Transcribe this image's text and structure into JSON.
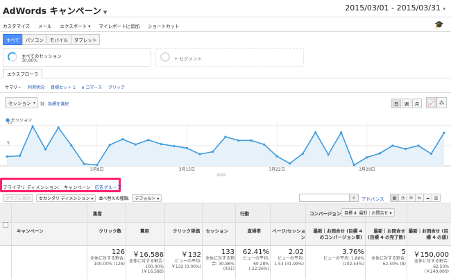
{
  "header": {
    "title": "AdWords キャンペーン",
    "date_range": "2015/03/01 - 2015/03/31"
  },
  "toolbar": {
    "items": [
      "カスタマイズ",
      "メール",
      "エクスポート ▾",
      "マイレポートに追加",
      "ショートカット"
    ]
  },
  "segment_buttons": [
    "すべて",
    "パソコン",
    "モバイル",
    "タブレット"
  ],
  "segments": {
    "primary_name": "すべてのセッション",
    "primary_value": "30.86%",
    "add_label": "+ セグメント"
  },
  "tab": "エクスプローラ",
  "subnav": [
    "サマリー",
    "利用状況",
    "目標セット 1",
    "e コマース",
    "クリック"
  ],
  "chart_controls": {
    "metric": "セッション",
    "vs": "対",
    "new_metric": "指標を選択",
    "periods": [
      "日",
      "週",
      "月"
    ]
  },
  "colors": {
    "accent": "#4d90fe",
    "line": "#3f9bdc",
    "highlight": "#ff1d6c",
    "link": "#1a55b5"
  },
  "chart_data": {
    "type": "area",
    "series": [
      {
        "name": "セッション",
        "values": [
          2.3,
          2.5,
          9.8,
          4.1,
          9.5,
          5.1,
          0.5,
          0.2,
          5.2,
          6.6,
          5.3,
          6.4,
          5.4,
          4.9,
          4.4,
          2.9,
          3.5,
          7.2,
          6.3,
          6.3,
          5.3,
          2.4,
          0.6,
          3.0,
          8.3,
          2.8,
          8.3,
          0.2,
          2.1,
          3.1,
          5.0,
          4.2,
          5.0,
          3.0,
          8.2
        ]
      }
    ],
    "x": [
      "2015-03-01",
      "2015-03-02",
      "2015-03-03",
      "2015-03-04",
      "2015-03-05",
      "2015-03-06",
      "2015-03-07",
      "2015-03-08",
      "2015-03-09",
      "2015-03-10",
      "2015-03-11",
      "2015-03-12",
      "2015-03-13",
      "2015-03-14",
      "2015-03-15",
      "2015-03-16",
      "2015-03-17",
      "2015-03-18",
      "2015-03-19",
      "2015-03-20",
      "2015-03-21",
      "2015-03-22",
      "2015-03-23",
      "2015-03-24",
      "2015-03-25",
      "2015-03-26",
      "2015-03-27",
      "2015-03-28",
      "2015-03-29",
      "2015-03-30",
      "2015-03-31",
      "2015-04-01",
      "2015-04-02",
      "2015-04-03",
      "2015-04-04"
    ],
    "x_tick_labels": [
      "3月8日",
      "3月15日",
      "3月22日",
      "3月29日"
    ],
    "y_tick_labels": [
      "10",
      "5"
    ],
    "ylim": [
      0,
      11
    ],
    "grid": true
  },
  "dimensions": {
    "label": "プライマリ ディメンション:",
    "active": "キャンペーン",
    "other": "広告グループ"
  },
  "table_controls": {
    "plot_rows": "グラフに表示",
    "secondary": "セカンダリ ディメンション ▾",
    "sort_label": "並べ替えの種類:",
    "sort_value": "デフォルト ▾",
    "advanced": "アドバンス"
  },
  "table": {
    "groups": [
      "集客",
      "行動",
      "コンバージョン"
    ],
    "conversion_select": "目標 4: 最新｜お問合せ ▾",
    "columns": [
      {
        "label": "キャンペーン"
      },
      {
        "label": "クリック数"
      },
      {
        "label": "費用"
      },
      {
        "label": "クリック単価"
      },
      {
        "label": "セッション"
      },
      {
        "label": "直帰率"
      },
      {
        "label": "ページ/セッション"
      },
      {
        "label": "最新｜お問合せ (目標 4 のコンバージョン率)"
      },
      {
        "label": "最新｜お問合せ (目標 4 の完了数)"
      },
      {
        "label": "最新｜お問合せ (目標 4 の値)"
      }
    ],
    "totals": [
      {
        "main": "126",
        "sub": "全体に対する割合: 100.00% (126)"
      },
      {
        "main": "￥16,586",
        "sub": "全体に対する割合: 100.00% (￥16,586)"
      },
      {
        "main": "￥132",
        "sub": "ビューの平均: ￥132 (0.00%)"
      },
      {
        "main": "133",
        "sub": "全体に対する割合: 30.86% (431)"
      },
      {
        "main": "62.41%",
        "sub": "ビューの平均: 60.28% (-22.26%)"
      },
      {
        "main": "2.02",
        "sub": "ビューの平均: 1.53 (31.99%)"
      },
      {
        "main": "3.76%",
        "sub": "ビューの平均: 1.86% (102.54%)"
      },
      {
        "main": "5",
        "sub": "全体に対する割合: 62.50% (8)"
      },
      {
        "main": "￥150,000",
        "sub": "全体に対する割合: 62.50% (￥240,000)"
      }
    ]
  }
}
